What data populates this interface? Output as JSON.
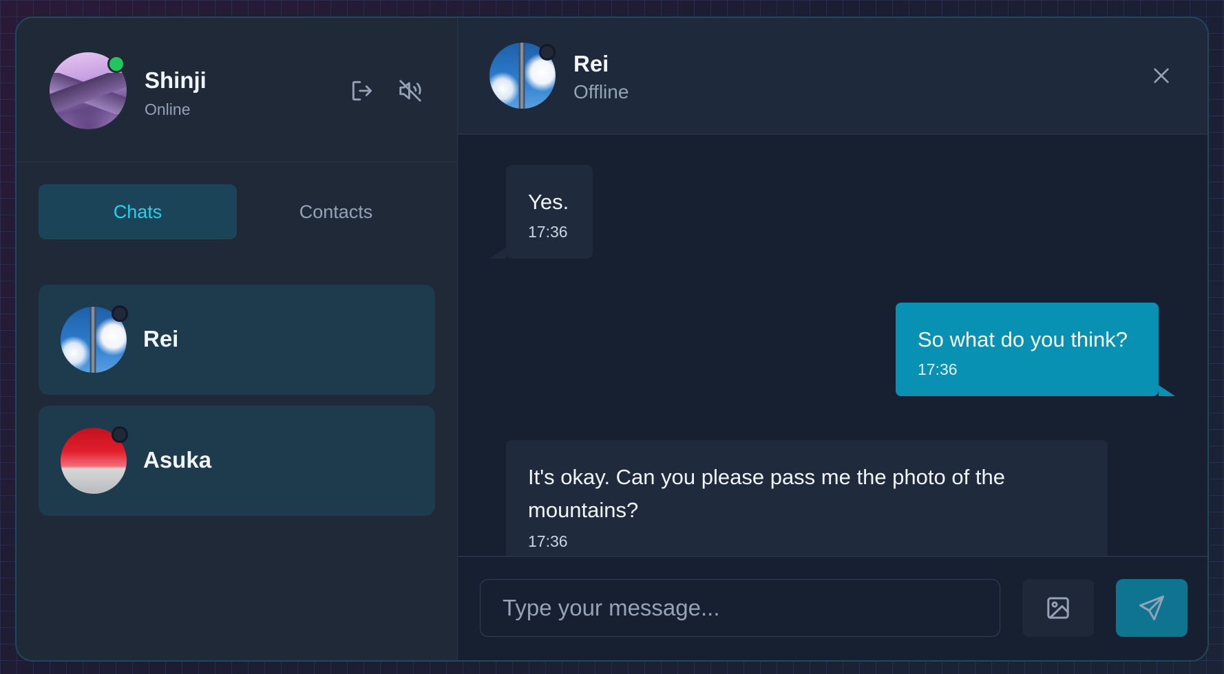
{
  "user": {
    "name": "Shinji",
    "status": "Online",
    "status_color": "#22c55e"
  },
  "header_actions": {
    "logout_icon": "logout-icon",
    "mute_icon": "speaker-muted-icon"
  },
  "tabs": [
    {
      "label": "Chats",
      "active": true
    },
    {
      "label": "Contacts",
      "active": false
    }
  ],
  "chats": [
    {
      "name": "Rei",
      "online": false
    },
    {
      "name": "Asuka",
      "online": false
    }
  ],
  "conversation": {
    "contact_name": "Rei",
    "contact_status": "Offline",
    "close_icon": "close-icon",
    "messages": [
      {
        "direction": "incoming",
        "text": "Yes.",
        "time": "17:36"
      },
      {
        "direction": "outgoing",
        "text": "So what do you think?",
        "time": "17:36"
      },
      {
        "direction": "incoming",
        "text": "It's okay. Can you please pass me the photo of the mountains?",
        "time": "17:36"
      }
    ]
  },
  "composer": {
    "placeholder": "Type your message...",
    "value": "",
    "image_icon": "image-icon",
    "send_icon": "send-icon"
  },
  "colors": {
    "accent": "#22d3ee",
    "outgoing_bubble": "#0891b2",
    "incoming_bubble": "#1f2a3d",
    "sidebar_bg": "#1f2937",
    "chat_bg": "#172031"
  }
}
